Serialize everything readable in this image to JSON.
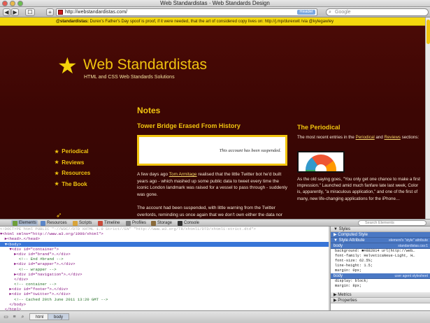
{
  "window": {
    "title": "Web Standardistas · Web Standards Design"
  },
  "toolbar": {
    "back": "◀",
    "forward": "▶",
    "bookmarks": "☐",
    "add": "+",
    "url": "http://webstandardistas.com/",
    "reader": "Reader",
    "search_placeholder": "Google"
  },
  "tweet": {
    "handle": "@standardistas:",
    "text": " Durex's Father's Day spoof is proof, if it were needed, that the art of considered copy lives on: http://j.mp/durexwit /via @kylegawley"
  },
  "site": {
    "title": "Web Standardistas",
    "subtitle": "HTML and CSS Web Standards Solutions",
    "nav": [
      "Periodical",
      "Reviews",
      "Resources",
      "The Book"
    ]
  },
  "notes": {
    "heading": "Notes",
    "post_title": "Tower Bridge Erased From History",
    "suspended": "This account has been suspended.",
    "para1_a": "A few days ago ",
    "para1_link": "Tom Armitage",
    "para1_b": " realised that the little Twitter bot he'd built years ago - which mashed up some public data to tweet every time the iconic London landmark was raised for a vessel to pass through - suddenly was gone.",
    "para2": "The account had been suspended, with little warning from the Twitter overlords, reminding us once again that we don't own either the data nor"
  },
  "sidebar": {
    "heading": "The Periodical",
    "intro_a": "The most recent entries in the ",
    "intro_link1": "Periodical",
    "intro_mid": " and ",
    "intro_link2": "Reviews",
    "intro_b": " sections:",
    "quote": "As the old saying goes, \"You only get one chance to make a first impression.\" Launched amid much fanfare late last week, Color is, apparently, \"a miraculous application,\" and one of the first of many, new life-changing applications for the iPhone…"
  },
  "devtools": {
    "tabs": [
      "Elements",
      "Resources",
      "Scripts",
      "Timeline",
      "Profiles",
      "Storage",
      "Console"
    ],
    "search_placeholder": "Search Elements",
    "dom": [
      {
        "t": "<!DOCTYPE html PUBLIC \"-//W3C//DTD XHTML 1.0 Strict//EN\" \"http://www.w3.org/TR/xhtml1/DTD/xhtml1-strict.dtd\">",
        "k": "d"
      },
      {
        "t": "▼<html xmlns=\"http://www.w3.org/1999/xhtml\">",
        "k": "t"
      },
      {
        "t": "  ▶<head>…</head>",
        "k": "t"
      },
      {
        "t": "  ▼<body>",
        "k": "sel"
      },
      {
        "t": "    ▼<div id=\"container\">",
        "k": "t"
      },
      {
        "t": "      ▶<div id=\"brand\">…</div>",
        "k": "t"
      },
      {
        "t": "        <!-- End #brand -->",
        "k": "c"
      },
      {
        "t": "      ▶<div id=\"wrapper\">…</div>",
        "k": "t"
      },
      {
        "t": "        <!-- wrapper -->",
        "k": "c"
      },
      {
        "t": "      ▶<div id=\"navigation\">…</div>",
        "k": "t"
      },
      {
        "t": "      </div>",
        "k": "t"
      },
      {
        "t": "      <!-- container -->",
        "k": "c"
      },
      {
        "t": "    ▶<div id=\"footer\">…</div>",
        "k": "t"
      },
      {
        "t": "    ▶<div id=\"twitter\">…</div>",
        "k": "t"
      },
      {
        "t": "      <!-- Cached 20th June 2011 13:20 GMT -->",
        "k": "c"
      },
      {
        "t": "    </body>",
        "k": "t"
      },
      {
        "t": "  </html>",
        "k": "t"
      }
    ],
    "styles": {
      "header": "Styles",
      "computed": "Computed Style",
      "attribute": "Style Attribute",
      "attribute_src": "element's \"style\" attribute",
      "rule1_selector": "body",
      "rule1_src": "standardistas.css:1",
      "rule1_props": [
        "background: ■#882814 url(http://web…",
        "font-family: HelveticaNeue-Light, H…",
        "font-size: 62.5%;",
        "line-height: 1.5;",
        "margin: 0px;"
      ],
      "rule2_selector": "body",
      "rule2_src": "user agent stylesheet",
      "rule2_props": [
        "display: block;",
        "margin: 8px;"
      ],
      "metrics": "Metrics",
      "properties": "Properties"
    },
    "breadcrumb": [
      "html",
      "body"
    ]
  }
}
